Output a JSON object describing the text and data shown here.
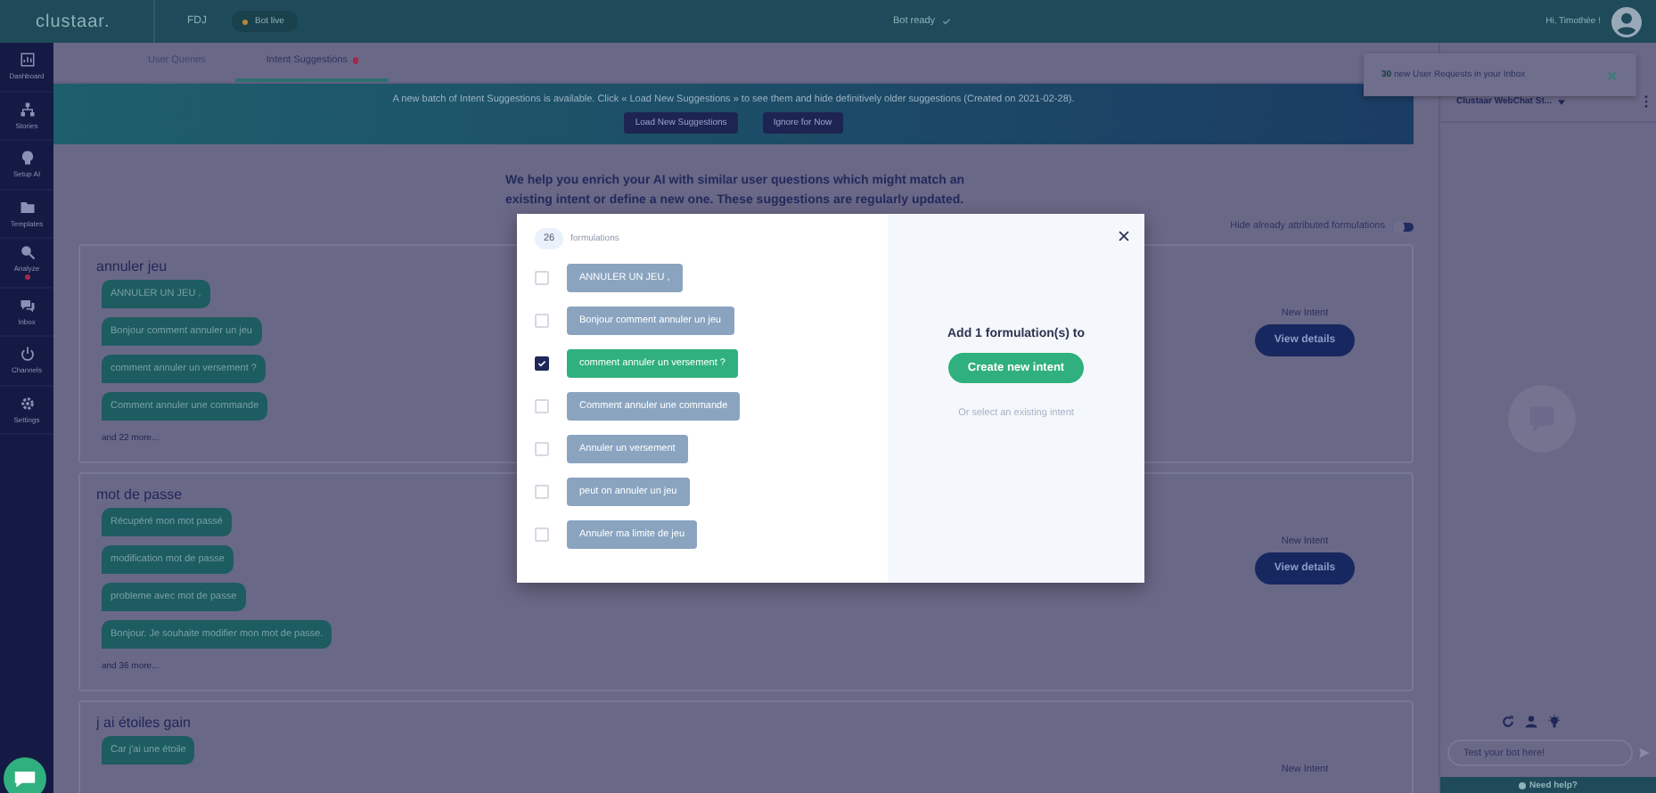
{
  "header": {
    "logo": "clustaar.",
    "project": "FDJ",
    "bot_status": {
      "label": "Bot live",
      "live": true
    },
    "bot_ready": "Bot ready",
    "greeting": "Hi, Timothée !"
  },
  "sidebar": {
    "items": [
      {
        "label": "Dashboard",
        "alert": false
      },
      {
        "label": "Stories",
        "alert": false
      },
      {
        "label": "Setup AI",
        "alert": false
      },
      {
        "label": "Templates",
        "alert": false
      },
      {
        "label": "Analyze",
        "alert": true
      },
      {
        "label": "Inbox",
        "alert": false
      },
      {
        "label": "Channels",
        "alert": false
      },
      {
        "label": "Settings",
        "alert": false
      }
    ]
  },
  "tabs": [
    {
      "label": "User Queries",
      "selected": false,
      "alert": false
    },
    {
      "label": "Intent Suggestions",
      "selected": true,
      "alert": true
    }
  ],
  "banner": {
    "text": "A new batch of Intent Suggestions is available. Click « Load New Suggestions » to see them and hide definitively older suggestions (Created on 2021-02-28).",
    "buttons": [
      "Load New Suggestions",
      "Ignore for Now"
    ]
  },
  "intro": "We help you enrich your AI with similar user questions which might match an existing intent or define a new one. These suggestions are regularly updated.",
  "hide_toggle": {
    "label": "Hide already attributed formulations",
    "on": true
  },
  "cards": [
    {
      "title": "annuler jeu",
      "formulations": [
        "ANNULER UN JEU ,",
        "Bonjour comment annuler un jeu",
        "comment annuler un versement ?",
        "Comment annuler une commande"
      ],
      "more": "and 22 more...",
      "intent_label": "New Intent",
      "button": "View details"
    },
    {
      "title": "mot de passe",
      "formulations": [
        "Récupéré mon mot passé",
        "modification mot de passe",
        "probleme avec mot de passe",
        "Bonjour. Je souhaite modifier mon mot de passe."
      ],
      "more": "and 36 more...",
      "intent_label": "New Intent",
      "button": "View details"
    },
    {
      "title": "j ai étoiles gain",
      "formulations": [
        "Car j'ai une étoile"
      ],
      "intent_label": "New Intent"
    }
  ],
  "chat_panel": {
    "channel": "Clustaar WebChat St...",
    "input_placeholder": "Test your bot here!",
    "help": "Need help?"
  },
  "toast": {
    "count": "30",
    "text": "new User Requests in your Inbox"
  },
  "modal": {
    "count": "26",
    "count_label": "formulations",
    "items": [
      {
        "text": "ANNULER UN JEU ,",
        "checked": false
      },
      {
        "text": "Bonjour comment annuler un jeu",
        "checked": false
      },
      {
        "text": "comment annuler un versement ?",
        "checked": true
      },
      {
        "text": "Comment annuler une commande",
        "checked": false
      },
      {
        "text": "Annuler un versement",
        "checked": false
      },
      {
        "text": "peut on annuler un jeu",
        "checked": false
      },
      {
        "text": "Annuler ma limite de jeu",
        "checked": false
      }
    ],
    "add_text": "Add 1 formulation(s) to",
    "create_button": "Create new intent",
    "existing_link": "Or select an existing intent"
  }
}
